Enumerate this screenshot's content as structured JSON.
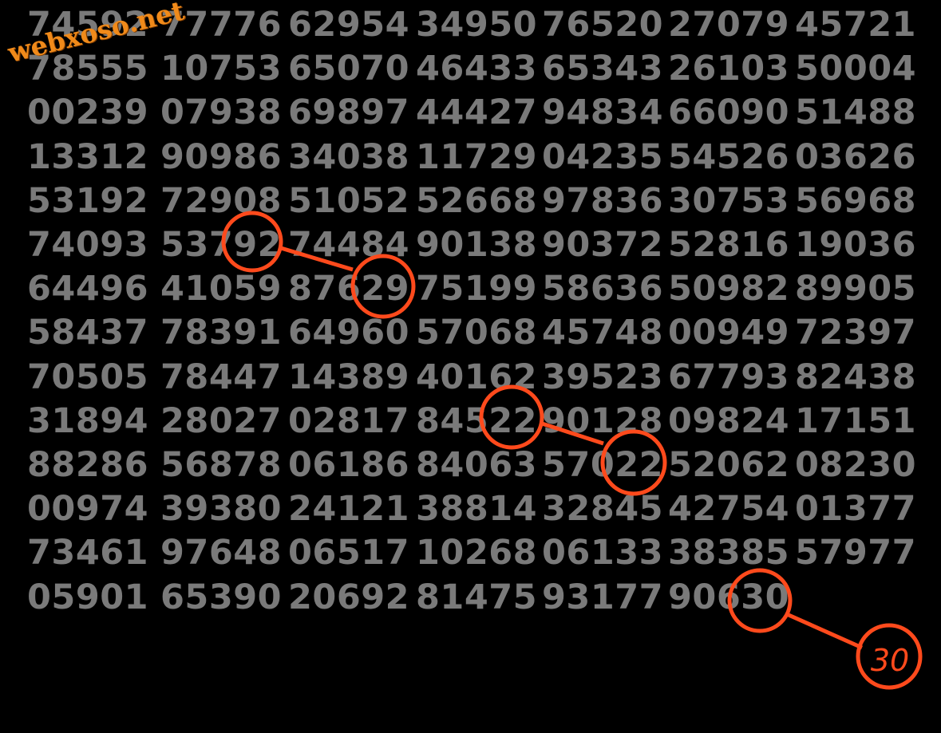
{
  "watermark": "webxoso.net",
  "grid": [
    [
      "74592",
      "77776",
      "62954",
      "34950",
      "76520",
      "27079",
      "45721"
    ],
    [
      "78555",
      "10753",
      "65070",
      "46433",
      "65343",
      "26103",
      "50004"
    ],
    [
      "00239",
      "07938",
      "69897",
      "44427",
      "94834",
      "66090",
      "51488"
    ],
    [
      "13312",
      "90986",
      "34038",
      "11729",
      "04235",
      "54526",
      "03626"
    ],
    [
      "53192",
      "72908",
      "51052",
      "52668",
      "97836",
      "30753",
      "56968"
    ],
    [
      "74093",
      "53792",
      "74484",
      "90138",
      "90372",
      "52816",
      "19036"
    ],
    [
      "64496",
      "41059",
      "87629",
      "75199",
      "58636",
      "50982",
      "89905"
    ],
    [
      "58437",
      "78391",
      "64960",
      "57068",
      "45748",
      "00949",
      "72397"
    ],
    [
      "70505",
      "78447",
      "14389",
      "40162",
      "39523",
      "67793",
      "82438"
    ],
    [
      "31894",
      "28027",
      "02817",
      "84522",
      "90128",
      "09824",
      "17151"
    ],
    [
      "88286",
      "56878",
      "06186",
      "84063",
      "57022",
      "52062",
      "08230"
    ],
    [
      "00974",
      "39380",
      "24121",
      "38814",
      "32845",
      "42754",
      "01377"
    ],
    [
      "73461",
      "97648",
      "06517",
      "10268",
      "06133",
      "38385",
      "57977"
    ],
    [
      "05901",
      "65390",
      "20692",
      "81475",
      "93177",
      "90630"
    ]
  ],
  "result": "30",
  "colors": {
    "background": "#000000",
    "digits": "#7a7a7a",
    "watermark": "#f08a1a",
    "annotation": "#ff4a1c"
  }
}
